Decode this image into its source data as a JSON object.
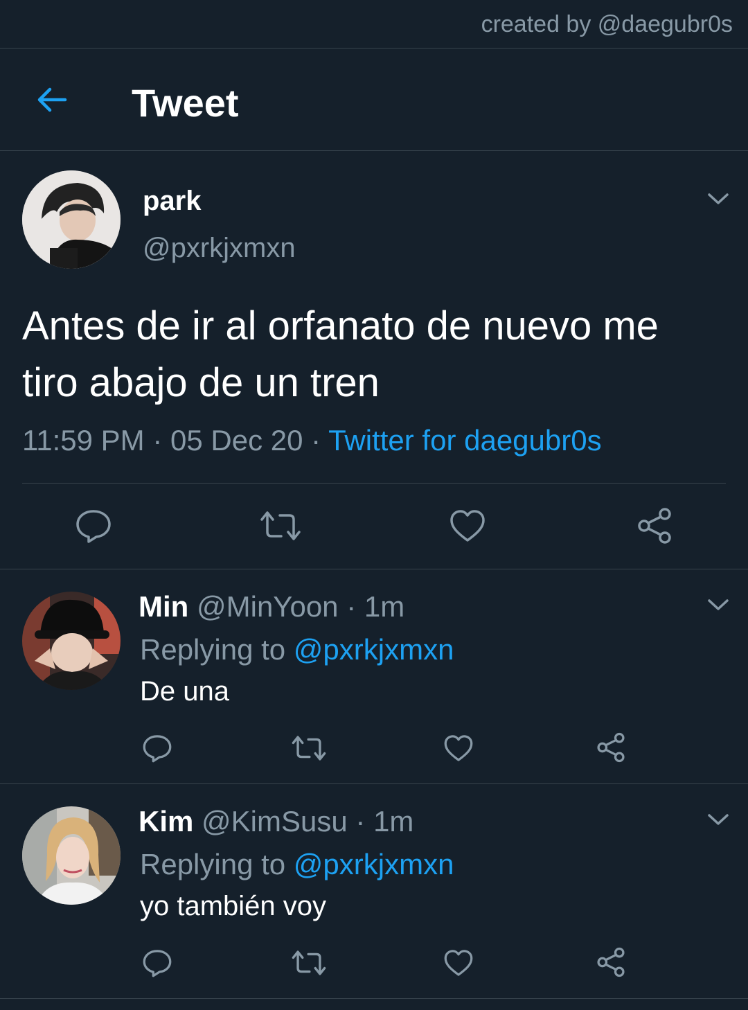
{
  "credit": "created by @daegubr0s",
  "header": {
    "title": "Tweet",
    "back_icon": "arrow-left-icon"
  },
  "colors": {
    "background": "#15202b",
    "accent": "#1da1f2",
    "muted": "#8899a6",
    "divider": "#38444d"
  },
  "main_tweet": {
    "name": "park",
    "handle": "@pxrkjxmxn",
    "text_line1": "Antes de ir al orfanato de nuevo me",
    "text_line2": "tiro abajo de un tren",
    "time": "11:59 PM",
    "date": "05 Dec 20",
    "separator": "·",
    "source": "Twitter for daegubr0s"
  },
  "replies": [
    {
      "name": "Min",
      "handle": "@MinYoon",
      "time": "1m",
      "replying_label": "Replying to",
      "replying_to": "@pxrkjxmxn",
      "text": "De una"
    },
    {
      "name": "Kim",
      "handle": "@KimSusu",
      "time": "1m",
      "replying_label": "Replying to",
      "replying_to": "@pxrkjxmxn",
      "text": "yo también voy"
    }
  ],
  "actions": [
    "reply-icon",
    "retweet-icon",
    "like-icon",
    "share-icon"
  ]
}
